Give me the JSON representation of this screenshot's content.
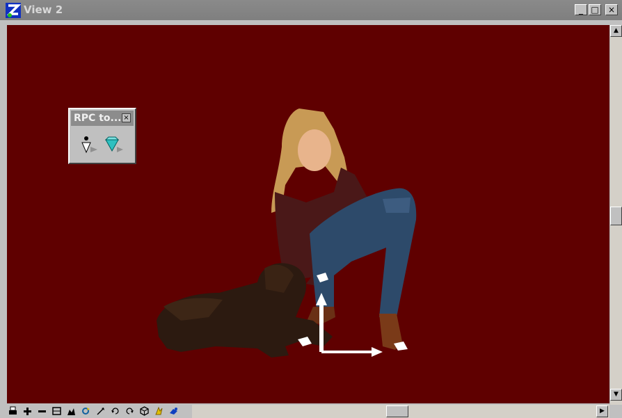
{
  "window": {
    "title": "View 2",
    "minimize": "_",
    "maximize": "□",
    "close": "×"
  },
  "toolbox": {
    "title": "RPC to...",
    "close": "×",
    "tools": [
      "place-rpc-icon",
      "edit-rpc-icon"
    ]
  },
  "view_tools": [
    "print-icon",
    "zoom-in-icon",
    "zoom-out-icon",
    "window-area-icon",
    "fit-view-icon",
    "rotate-view-icon",
    "pan-view-icon",
    "undo-view-icon",
    "redo-view-icon",
    "view-previous-icon",
    "render-icon",
    "camera-icon",
    "scroll-left-icon"
  ],
  "scroll": {
    "up": "▲",
    "down": "▼",
    "left": "◀",
    "right": "▶"
  },
  "colors": {
    "viewport_bg": "#5f0000",
    "chrome": "#c0c0c0",
    "titlebar": "#808080"
  }
}
